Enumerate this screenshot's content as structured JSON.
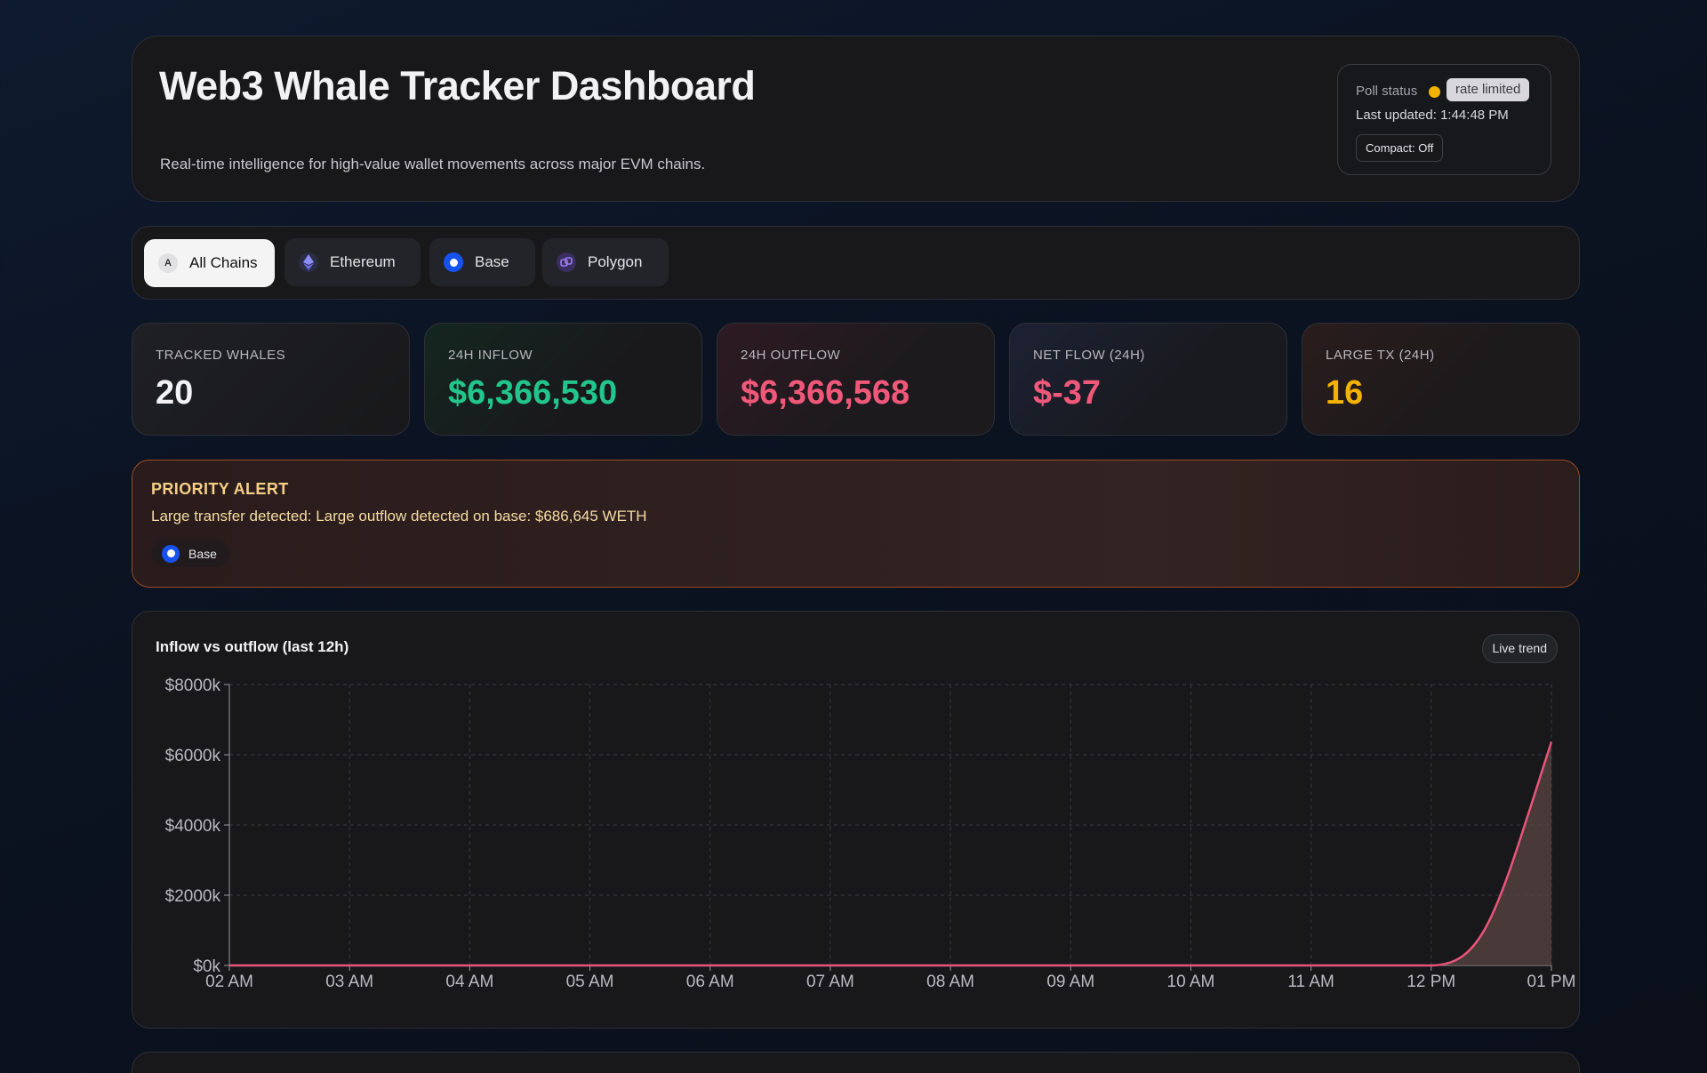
{
  "header": {
    "title": "Web3 Whale Tracker Dashboard",
    "subtitle": "Real-time intelligence for high-value wallet movements across major EVM chains.",
    "poll_label": "Poll status",
    "poll_badge": "rate limited",
    "last_updated": "Last updated: 1:44:48 PM",
    "compact_label": "Compact: Off"
  },
  "chains": [
    {
      "label": "All Chains",
      "icon": "A",
      "active": true
    },
    {
      "label": "Ethereum",
      "icon": "ethereum-icon"
    },
    {
      "label": "Base",
      "icon": "base-icon"
    },
    {
      "label": "Polygon",
      "icon": "polygon-icon"
    }
  ],
  "stats": {
    "whales": {
      "label": "TRACKED WHALES",
      "value": "20",
      "color": "#f2f2f4"
    },
    "inflow": {
      "label": "24H INFLOW",
      "value": "$6,366,530",
      "color": "#22c58b"
    },
    "outflow": {
      "label": "24H OUTFLOW",
      "value": "$6,366,568",
      "color": "#f0587a"
    },
    "net": {
      "label": "NET FLOW (24H)",
      "value": "$-37",
      "color": "#f0587a"
    },
    "large": {
      "label": "LARGE TX (24H)",
      "value": "16",
      "color": "#f5b301"
    }
  },
  "alert": {
    "title": "PRIORITY ALERT",
    "text": "Large transfer detected: Large outflow detected on base: $686,645 WETH",
    "chain": "Base"
  },
  "chart": {
    "title": "Inflow vs outflow (last 12h)",
    "badge": "Live trend"
  },
  "chart_data": {
    "type": "area",
    "x": [
      "02 AM",
      "03 AM",
      "04 AM",
      "05 AM",
      "06 AM",
      "07 AM",
      "08 AM",
      "09 AM",
      "10 AM",
      "11 AM",
      "12 PM",
      "01 PM"
    ],
    "series": [
      {
        "values": [
          0,
          0,
          0,
          0,
          0,
          0,
          0,
          0,
          0,
          0,
          0,
          6366.5
        ],
        "color": "#e9557a"
      }
    ],
    "yticks": [
      "$0k",
      "$2000k",
      "$4000k",
      "$6000k",
      "$8000k"
    ],
    "ylim": [
      0,
      8000
    ],
    "grid": true
  }
}
